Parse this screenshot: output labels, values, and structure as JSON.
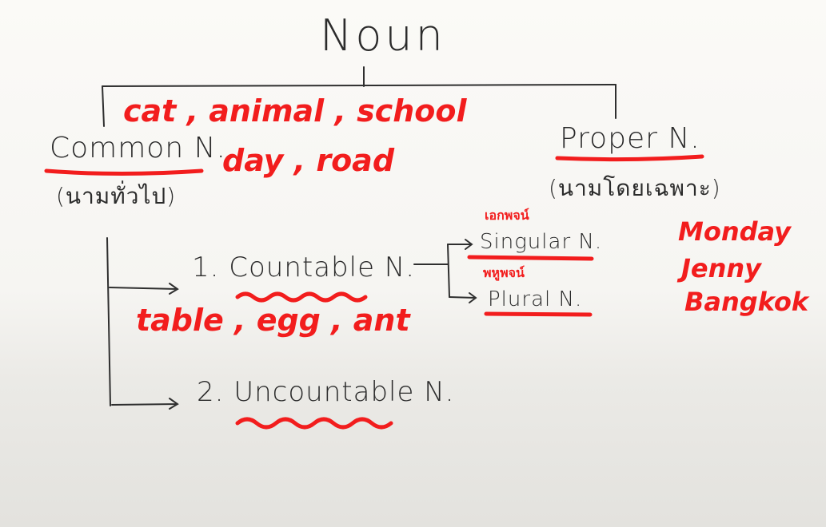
{
  "diagram": {
    "root": "Noun",
    "common": {
      "label": "Common N.",
      "thai": "(นามทั่วไป)",
      "examples_line1": "cat , animal , school",
      "examples_line2": "day , road"
    },
    "proper": {
      "label": "Proper N.",
      "thai": "(นามโดยเฉพาะ)",
      "examples": [
        "Monday",
        "Jenny",
        "Bangkok"
      ]
    },
    "countable": {
      "label": "1. Countable N.",
      "examples": "table , egg , ant"
    },
    "uncountable": {
      "label": "2. Uncountable N."
    },
    "singular": {
      "label": "Singular N.",
      "thai": "เอกพจน์"
    },
    "plural": {
      "label": "Plural N.",
      "thai": "พหูพจน์"
    }
  },
  "colors": {
    "ink": "#2b2b2b",
    "marker_red": "#f21d1d",
    "board": "#f8f7f4"
  }
}
